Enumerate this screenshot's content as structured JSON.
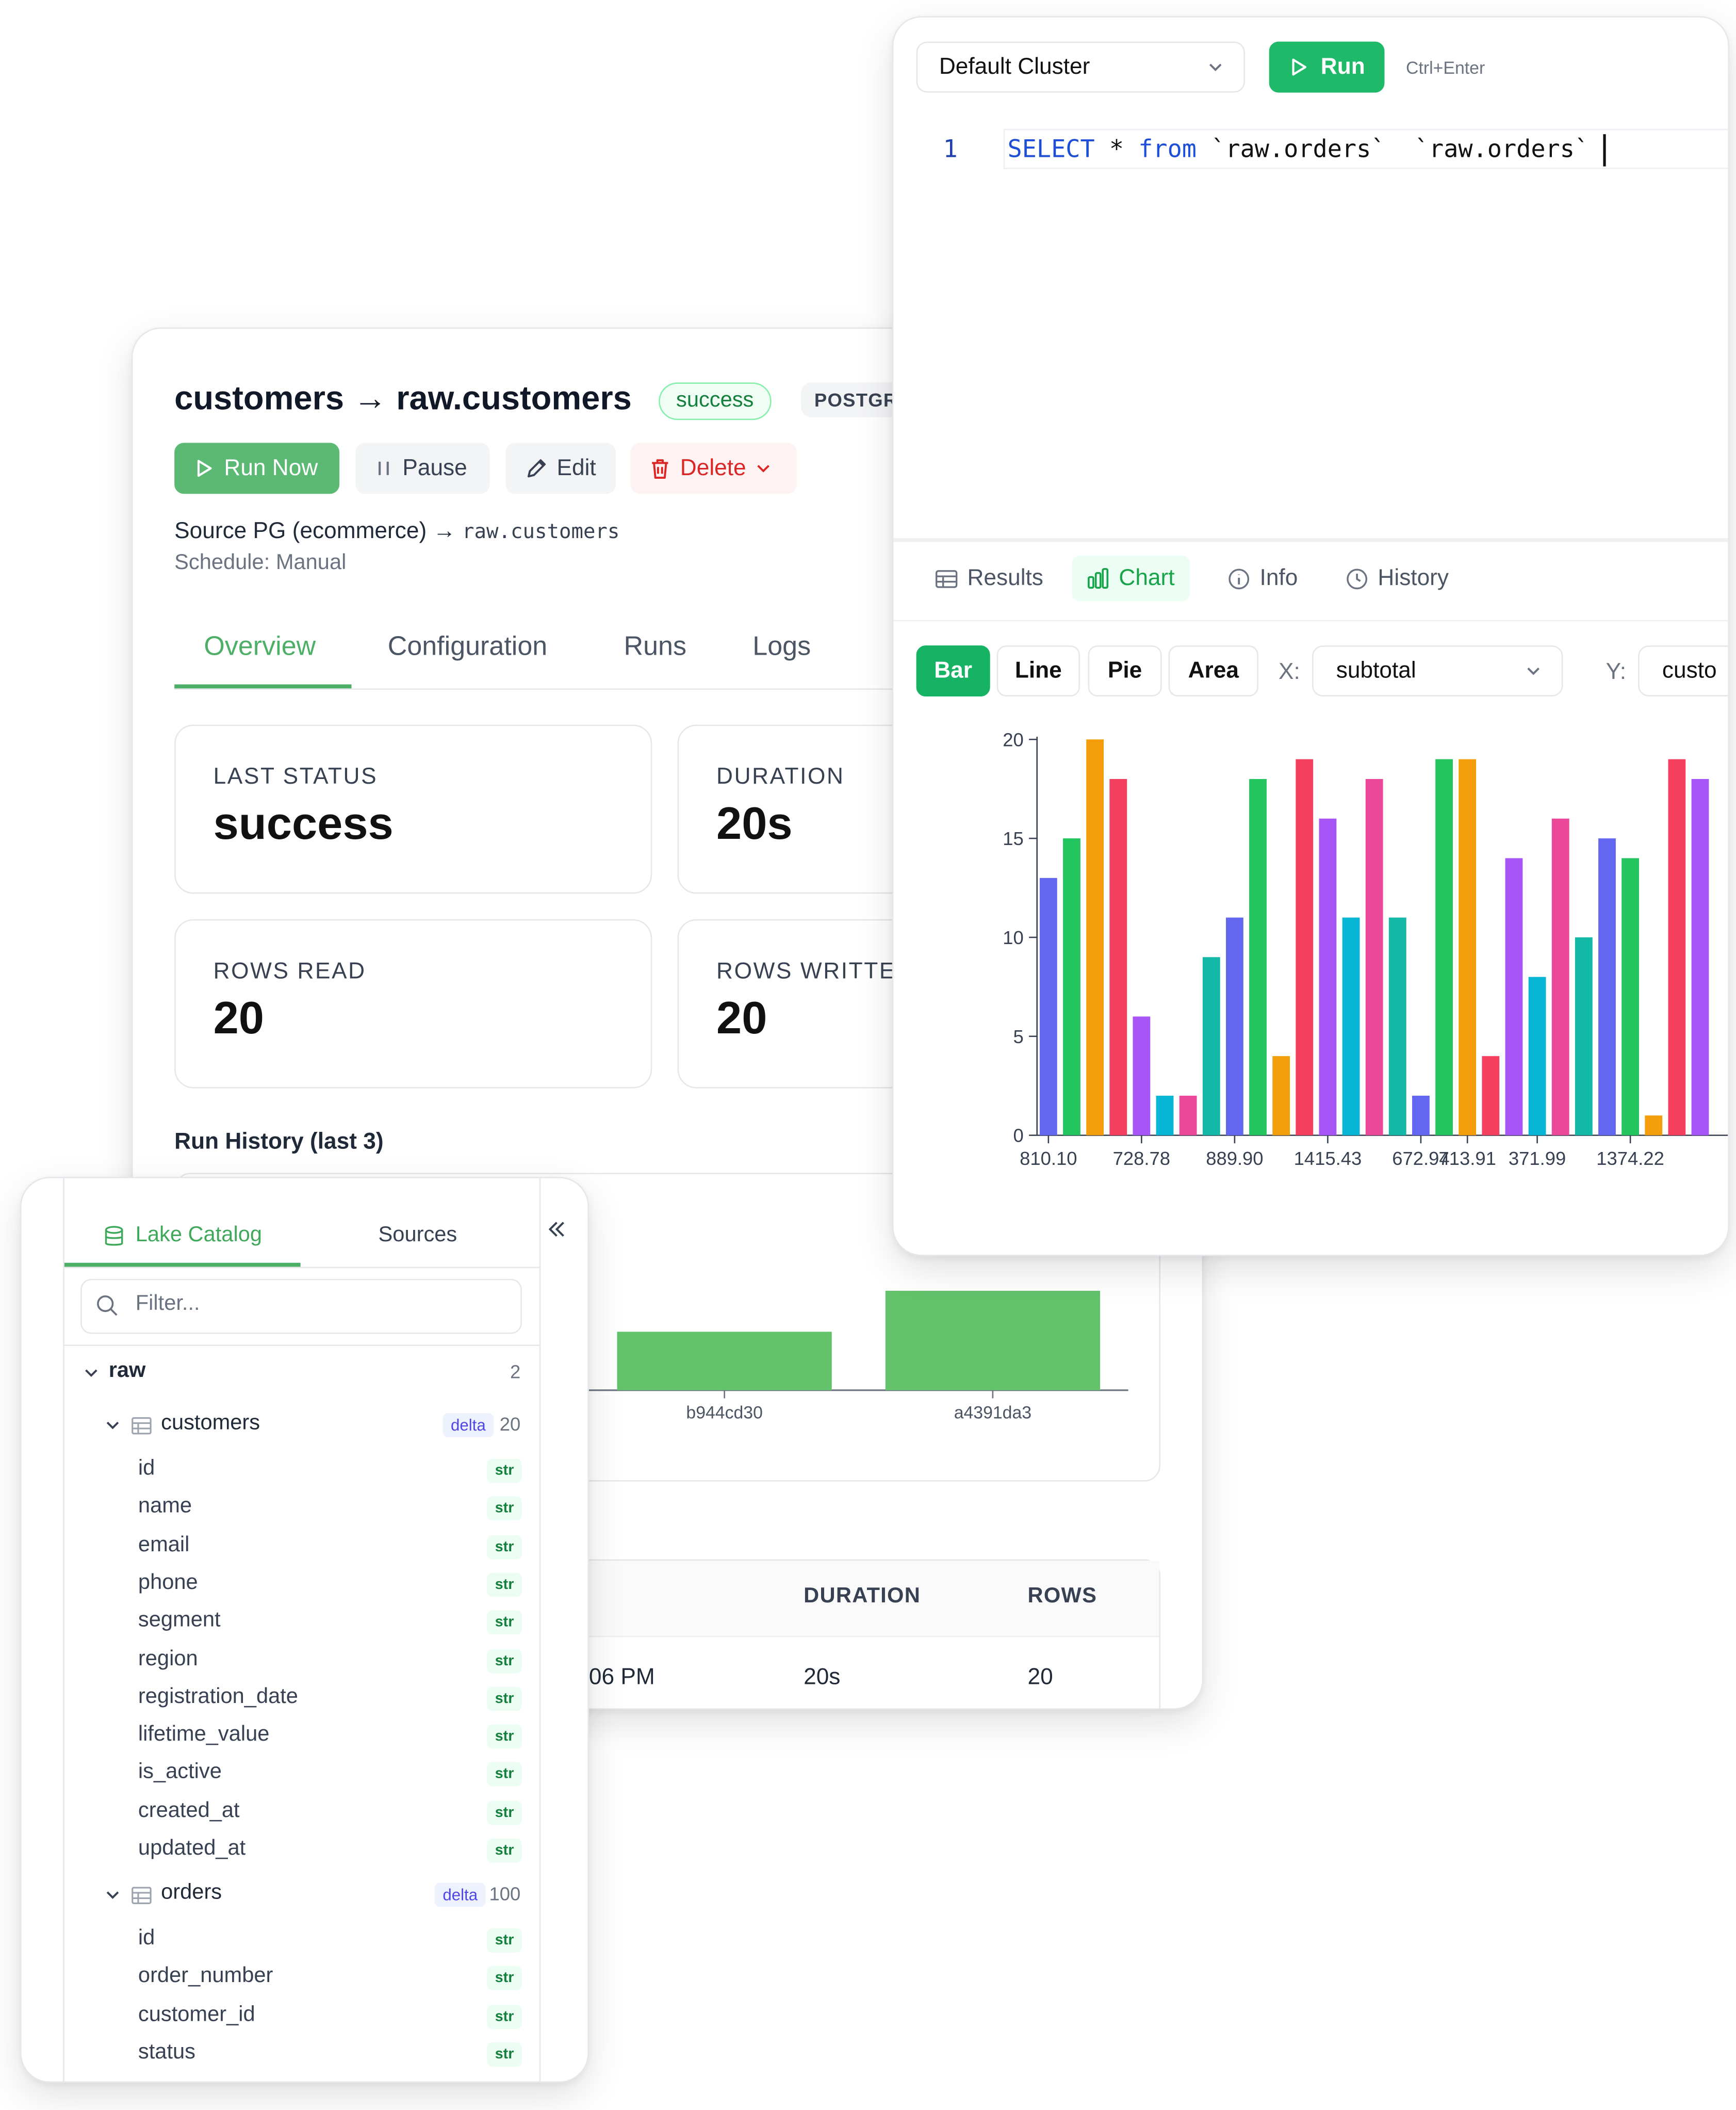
{
  "job": {
    "title": "customers → raw.customers",
    "status_badge": "success",
    "source_badge": "POSTGR",
    "buttons": {
      "run_now": "Run Now",
      "pause": "Pause",
      "edit": "Edit",
      "delete": "Delete"
    },
    "source_name": "Source PG (ecommerce)",
    "arrow": "→",
    "source_target": "raw.customers",
    "schedule": "Schedule: Manual",
    "tabs": [
      "Overview",
      "Configuration",
      "Runs",
      "Logs"
    ],
    "active_tab": "Overview",
    "stats": [
      {
        "label": "LAST STATUS",
        "value": "success"
      },
      {
        "label": "DURATION",
        "value": "20s"
      },
      {
        "label": "ROWS READ",
        "value": "20"
      },
      {
        "label": "ROWS WRITTEN",
        "value": "20"
      }
    ],
    "run_history_title": "Run History (last 3)",
    "run_history_chart": {
      "type": "bar",
      "categories": [
        "b944cd30",
        "a4391da3"
      ],
      "values": [
        20,
        34
      ],
      "bar_color": "#62c36b"
    },
    "runs_table": {
      "headers": {
        "duration": "DURATION",
        "rows": "ROWS"
      },
      "rows": [
        {
          "time": "06 PM",
          "duration": "20s",
          "rows": "20"
        }
      ]
    }
  },
  "query": {
    "cluster": "Default Cluster",
    "run_label": "Run",
    "shortcut_hint": "Ctrl+Enter",
    "line_number": "1",
    "code": {
      "kw_select": "SELECT",
      "star": " * ",
      "kw_from": "from",
      "rest": " `raw.orders`  `raw.orders`"
    },
    "result_tabs": [
      "Results",
      "Chart",
      "Info",
      "History"
    ],
    "active_result_tab": "Chart",
    "chart_types": [
      "Bar",
      "Line",
      "Pie",
      "Area"
    ],
    "active_chart_type": "Bar",
    "x_label": "X:",
    "x_field": "subtotal",
    "y_label": "Y:",
    "y_field": "custo",
    "accent": "#16b364"
  },
  "catalog": {
    "tabs": [
      "Lake Catalog",
      "Sources"
    ],
    "active_tab": "Lake Catalog",
    "collapse_icon": "chevrons-left-icon",
    "filter_placeholder": "Filter...",
    "root": {
      "name": "raw",
      "count": "2"
    },
    "tables": [
      {
        "name": "customers",
        "format": "delta",
        "count": "20",
        "columns": [
          {
            "name": "id",
            "type": "str"
          },
          {
            "name": "name",
            "type": "str"
          },
          {
            "name": "email",
            "type": "str"
          },
          {
            "name": "phone",
            "type": "str"
          },
          {
            "name": "segment",
            "type": "str"
          },
          {
            "name": "region",
            "type": "str"
          },
          {
            "name": "registration_date",
            "type": "str"
          },
          {
            "name": "lifetime_value",
            "type": "str"
          },
          {
            "name": "is_active",
            "type": "str"
          },
          {
            "name": "created_at",
            "type": "str"
          },
          {
            "name": "updated_at",
            "type": "str"
          }
        ]
      },
      {
        "name": "orders",
        "format": "delta",
        "count": "100",
        "columns": [
          {
            "name": "id",
            "type": "str"
          },
          {
            "name": "order_number",
            "type": "str"
          },
          {
            "name": "customer_id",
            "type": "str"
          },
          {
            "name": "status",
            "type": "str"
          }
        ]
      }
    ]
  },
  "chart_data": {
    "type": "bar",
    "ylim": [
      0,
      20
    ],
    "yticks": [
      0,
      5,
      10,
      15,
      20
    ],
    "xtick_labels": [
      "810.10",
      "728.78",
      "889.90",
      "1415.43",
      "672.94",
      "713.91",
      "371.99",
      "1374.22"
    ],
    "xtick_bar_index": [
      0,
      4,
      8,
      12,
      16,
      18,
      21,
      25
    ],
    "values": [
      13,
      15,
      20,
      18,
      6,
      2,
      2,
      9,
      11,
      18,
      4,
      19,
      16,
      11,
      18,
      11,
      2,
      19,
      19,
      4,
      14,
      8,
      16,
      10,
      15,
      14,
      1,
      19,
      18
    ],
    "colors": [
      "#6366f1",
      "#22c55e",
      "#f59e0b",
      "#f43f5e",
      "#a855f7",
      "#06b6d4",
      "#ec4899",
      "#14b8a6",
      "#6366f1",
      "#22c55e",
      "#f59e0b",
      "#f43f5e",
      "#a855f7",
      "#06b6d4",
      "#ec4899",
      "#14b8a6",
      "#6366f1",
      "#22c55e",
      "#f59e0b",
      "#f43f5e",
      "#a855f7",
      "#06b6d4",
      "#ec4899",
      "#14b8a6",
      "#6366f1",
      "#22c55e",
      "#f59e0b",
      "#f43f5e",
      "#a855f7"
    ]
  }
}
